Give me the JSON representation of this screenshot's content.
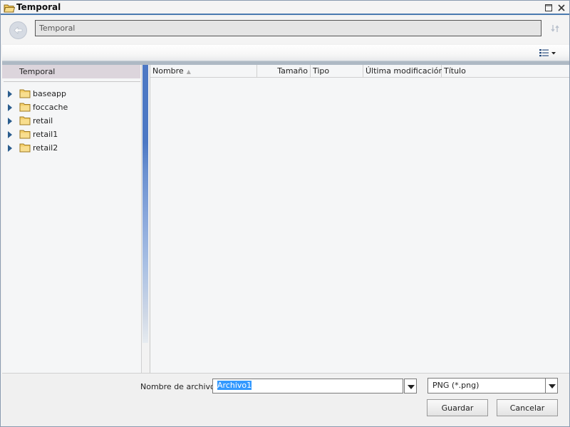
{
  "window": {
    "title": "Temporal"
  },
  "nav": {
    "path": "Temporal"
  },
  "tree": {
    "header": "Temporal",
    "items": [
      {
        "label": "baseapp"
      },
      {
        "label": "foccache"
      },
      {
        "label": "retail"
      },
      {
        "label": "retail1"
      },
      {
        "label": "retail2"
      }
    ]
  },
  "columns": {
    "nombre": "Nombre",
    "tamano": "Tamaño",
    "tipo": "Tipo",
    "ultima": "Última modificación",
    "titulo": "Título"
  },
  "footer": {
    "filename_label": "Nombre de archivo:",
    "filename_value": "Archivo1",
    "filetype_value": "PNG (*.png)",
    "save_label": "Guardar",
    "cancel_label": "Cancelar"
  },
  "colors": {
    "title_accent": "#4a7ab0",
    "splitter": "#4d78c4",
    "selection": "#3399ff"
  }
}
